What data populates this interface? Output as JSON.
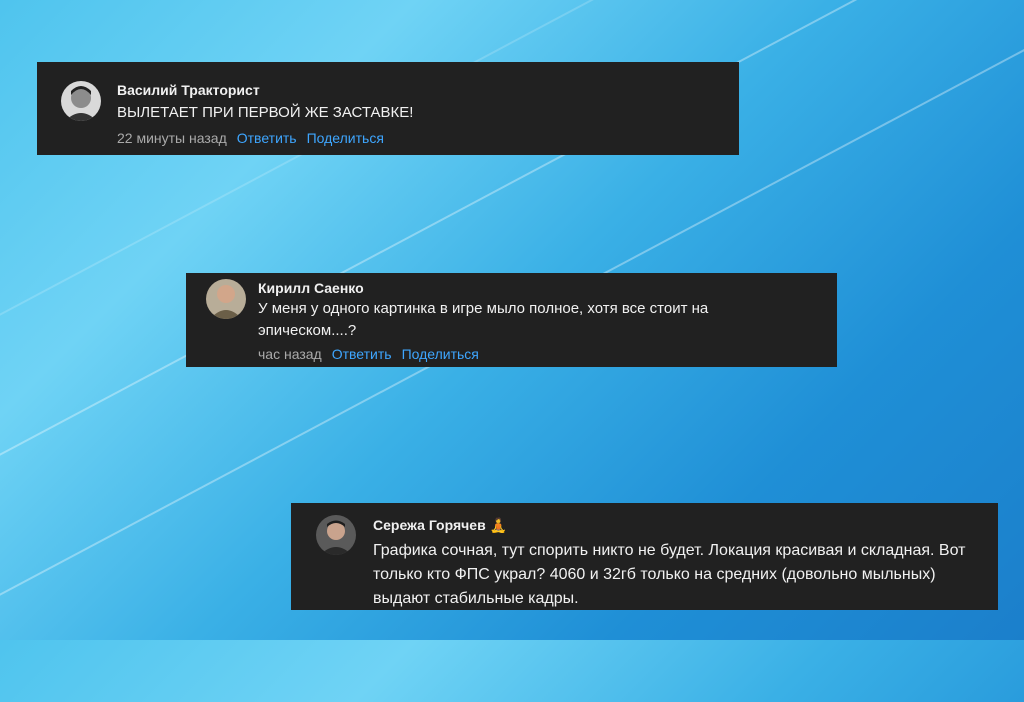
{
  "comments": [
    {
      "author": "Василий Тракторист",
      "author_emoji": "",
      "text": "ВЫЛЕТАЕТ ПРИ ПЕРВОЙ ЖЕ ЗАСТАВКЕ!",
      "time": "22 минуты назад",
      "reply": "Ответить",
      "share": "Поделиться"
    },
    {
      "author": "Кирилл Саенко",
      "author_emoji": "",
      "text": "У меня у одного картинка в игре мыло полное, хотя все стоит на эпическом....?",
      "time": "час назад",
      "reply": "Ответить",
      "share": "Поделиться"
    },
    {
      "author": "Сережа Горячев",
      "author_emoji": "🧘",
      "text": "Графика сочная, тут спорить никто не будет. Локация красивая и складная. Вот только кто ФПС украл? 4060 и 32гб только на средних (довольно мыльных) выдают стабильные кадры."
    }
  ],
  "colors": {
    "card_bg": "#212121",
    "link": "#3ea6ff",
    "meta": "#aaaaaa"
  }
}
